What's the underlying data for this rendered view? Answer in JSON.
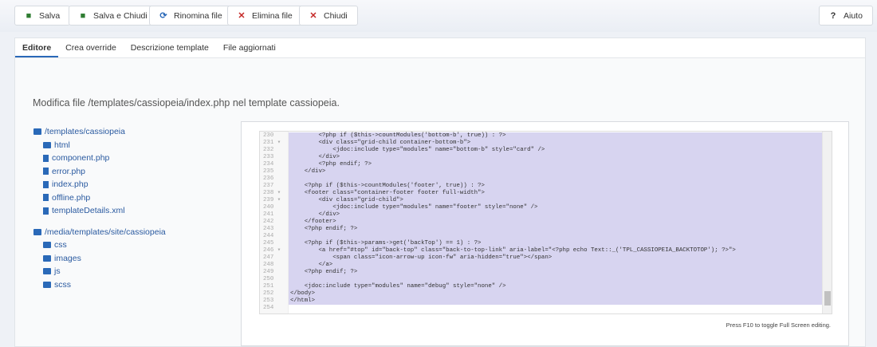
{
  "toolbar": {
    "save": "Salva",
    "save_close": "Salva e Chiudi",
    "rename": "Rinomina file",
    "delete": "Elimina file",
    "close": "Chiudi",
    "help": "Aiuto"
  },
  "tabs": [
    "Editore",
    "Crea override",
    "Descrizione template",
    "File aggiornati"
  ],
  "description": "Modifica file /templates/cassiopeia/index.php nel template cassiopeia.",
  "tree": {
    "root1": "/templates/cassiopeia",
    "items1": [
      {
        "type": "folder",
        "label": "html"
      },
      {
        "type": "file",
        "label": "component.php"
      },
      {
        "type": "file",
        "label": "error.php"
      },
      {
        "type": "file",
        "label": "index.php"
      },
      {
        "type": "file",
        "label": "offline.php"
      },
      {
        "type": "file",
        "label": "templateDetails.xml"
      }
    ],
    "root2": "/media/templates/site/cassiopeia",
    "items2": [
      {
        "type": "folder",
        "label": "css"
      },
      {
        "type": "folder",
        "label": "images"
      },
      {
        "type": "folder",
        "label": "js"
      },
      {
        "type": "folder",
        "label": "scss"
      }
    ]
  },
  "editor": {
    "lines": [
      {
        "n": "230",
        "c": "        <?php if ($this->countModules('bottom-b', true)) : ?>"
      },
      {
        "n": "231 ▾",
        "c": "        <div class=\"grid-child container-bottom-b\">"
      },
      {
        "n": "232",
        "c": "            <jdoc:include type=\"modules\" name=\"bottom-b\" style=\"card\" />"
      },
      {
        "n": "233",
        "c": "        </div>"
      },
      {
        "n": "234",
        "c": "        <?php endif; ?>"
      },
      {
        "n": "235",
        "c": "    </div>"
      },
      {
        "n": "236",
        "c": ""
      },
      {
        "n": "237",
        "c": "    <?php if ($this->countModules('footer', true)) : ?>"
      },
      {
        "n": "238 ▾",
        "c": "    <footer class=\"container-footer footer full-width\">"
      },
      {
        "n": "239 ▾",
        "c": "        <div class=\"grid-child\">"
      },
      {
        "n": "240",
        "c": "            <jdoc:include type=\"modules\" name=\"footer\" style=\"none\" />"
      },
      {
        "n": "241",
        "c": "        </div>"
      },
      {
        "n": "242",
        "c": "    </footer>"
      },
      {
        "n": "243",
        "c": "    <?php endif; ?>"
      },
      {
        "n": "244",
        "c": ""
      },
      {
        "n": "245",
        "c": "    <?php if ($this->params->get('backTop') == 1) : ?>"
      },
      {
        "n": "246 ▾",
        "c": "        <a href=\"#top\" id=\"back-top\" class=\"back-to-top-link\" aria-label=\"<?php echo Text::_('TPL_CASSIOPEIA_BACKTOTOP'); ?>\">"
      },
      {
        "n": "247",
        "c": "            <span class=\"icon-arrow-up icon-fw\" aria-hidden=\"true\"></span>"
      },
      {
        "n": "248",
        "c": "        </a>"
      },
      {
        "n": "249",
        "c": "    <?php endif; ?>"
      },
      {
        "n": "250",
        "c": ""
      },
      {
        "n": "251",
        "c": "    <jdoc:include type=\"modules\" name=\"debug\" style=\"none\" />"
      },
      {
        "n": "252",
        "c": "</body>"
      },
      {
        "n": "253",
        "c": "</html>"
      },
      {
        "n": "254",
        "c": ""
      }
    ],
    "hint": "Press F10 to toggle Full Screen editing."
  }
}
